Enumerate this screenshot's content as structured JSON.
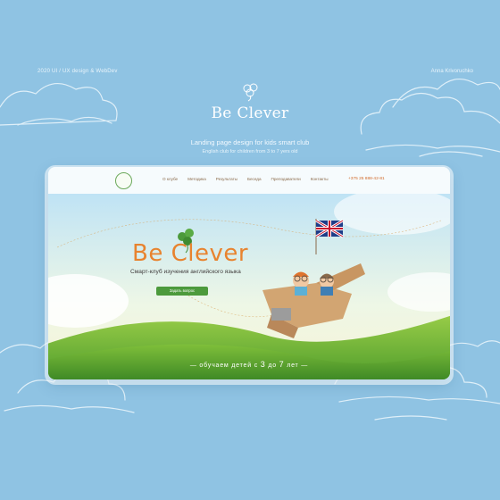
{
  "header": {
    "year_tag": "2020   UI / UX design & WebDev",
    "author": "Anna Krivoruchko",
    "brand": "Be Clever",
    "subtitle": "Landing page design for kids smart club",
    "subtitle2": "English club for children from 3 to 7 yers old"
  },
  "mockup": {
    "nav": {
      "items": [
        "О клубе",
        "Методика",
        "Результаты",
        "Беседа",
        "Преподаватели",
        "Контакты"
      ],
      "phone": "+375 25 888-42-81"
    },
    "hero": {
      "title": "Be Clever",
      "subtitle": "Смарт-клуб изучения английского языка",
      "button": "Задать вопрос",
      "bottom_prefix": "— обучаем детей с",
      "num_from": "3",
      "mid": "до",
      "num_to": "7",
      "suffix": "лет —"
    }
  },
  "colors": {
    "background": "#8fc3e3",
    "accent_orange": "#e8832e",
    "button_green": "#4c9a3c"
  }
}
